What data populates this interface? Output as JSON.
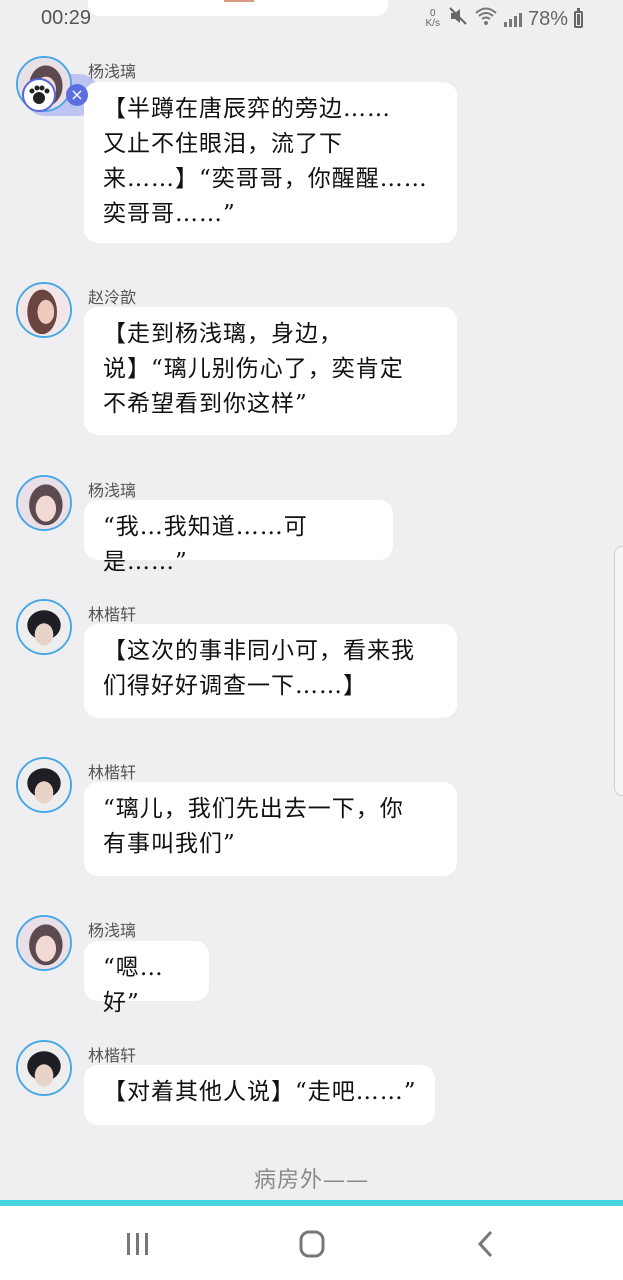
{
  "status_bar": {
    "time": "00:29",
    "net_speed_value": "0",
    "net_speed_unit": "K/s",
    "battery_percent": "78%",
    "icons": [
      "mute-icon",
      "wifi-icon",
      "signal-icon",
      "battery-icon"
    ]
  },
  "messages": [
    {
      "sender": "杨浅璃",
      "text": "【半蹲在唐辰弈的旁边……\n又止不住眼泪，流了下\n来……】“奕哥哥，你醒醒……\n奕哥哥……”",
      "avatar": "avatar-yang"
    },
    {
      "sender": "赵泠歆",
      "text": "【走到杨浅璃，身边，\n说】“璃儿别伤心了，奕肯定\n不希望看到你这样”",
      "avatar": "avatar-zhao"
    },
    {
      "sender": "杨浅璃",
      "text": "“我…我知道……可是……”",
      "avatar": "avatar-yang"
    },
    {
      "sender": "林楷轩",
      "text": "【这次的事非同小可，看来我\n们得好好调查一下……】",
      "avatar": "avatar-lin"
    },
    {
      "sender": "林楷轩",
      "text": "“璃儿，我们先出去一下，你\n有事叫我们”",
      "avatar": "avatar-lin"
    },
    {
      "sender": "杨浅璃",
      "text": "“嗯…好”",
      "avatar": "avatar-yang"
    },
    {
      "sender": "林楷轩",
      "text": "【对着其他人说】“走吧……”",
      "avatar": "avatar-lin"
    }
  ],
  "footer_text": "病房外——",
  "nav": {
    "icons": [
      "recent-apps-icon",
      "home-icon",
      "back-icon"
    ]
  },
  "colors": {
    "background": "#efeff1",
    "bubble": "#ffffff",
    "avatar_border": "#4aa7e6",
    "accent_line": "#46d4de"
  }
}
